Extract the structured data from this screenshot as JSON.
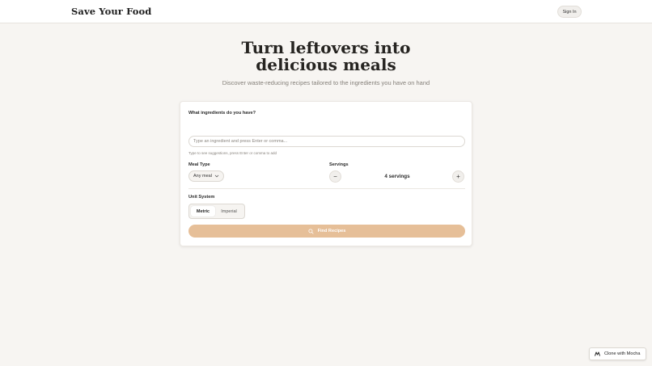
{
  "header": {
    "brand": "Save Your Food",
    "signin_label": "Sign In"
  },
  "hero": {
    "title_line1": "Turn leftovers into",
    "title_line2": "delicious meals",
    "subtitle": "Discover waste-reducing recipes tailored to the ingredients you have on hand"
  },
  "form": {
    "ingredients_label": "What ingredients do you have?",
    "ingredients_placeholder": "Type an ingredient and press Enter or comma...",
    "ingredients_hint": "Type to see suggestions, press Enter or comma to add",
    "meal_type_label": "Meal Type",
    "meal_type_value": "Any meal",
    "servings_label": "Servings",
    "servings_value": "4 servings",
    "servings_minus": "−",
    "servings_plus": "+",
    "unit_system_label": "Unit System",
    "unit_options": [
      "Metric",
      "Imperial"
    ],
    "unit_selected": "Metric",
    "find_button_label": "Find Recipes",
    "find_button_color": "#e6bf98"
  },
  "footer_badge": {
    "label": "Clone with Mocha"
  },
  "icons": {
    "meal_chevron": "chevron-down-icon",
    "find": "search-icon",
    "mocha": "mocha-logo-icon"
  }
}
